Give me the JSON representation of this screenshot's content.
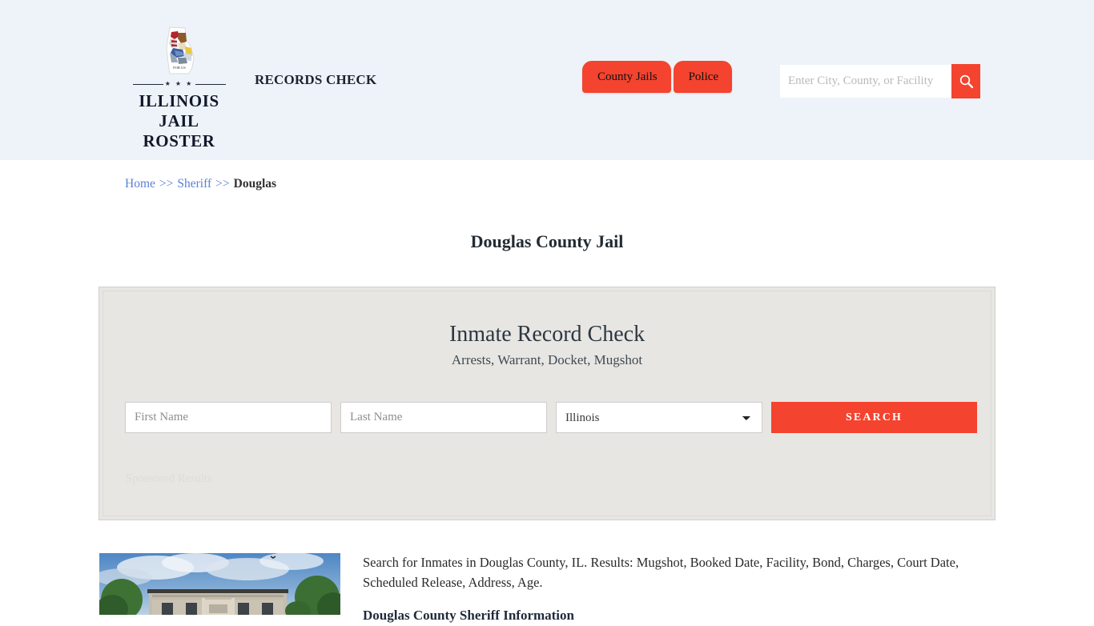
{
  "header": {
    "brand": {
      "line1": "ILLINOIS",
      "line2": "JAIL ROSTER",
      "stars": "★ ★ ★",
      "logo_icon": "illinois-state-seal-icon"
    },
    "tagline": "RECORDS CHECK",
    "nav": [
      {
        "label": "County Jails",
        "name": "nav-county-jails"
      },
      {
        "label": "Police",
        "name": "nav-police"
      }
    ],
    "search": {
      "placeholder": "Enter City, County, or Facility",
      "value": "",
      "button_icon": "search-icon"
    },
    "background_color": "#eef3f9",
    "accent_color": "#f4432e"
  },
  "breadcrumb": {
    "home": "Home",
    "sep1": ">>",
    "sheriff": "Sheriff",
    "sep2": ">>",
    "current": "Douglas"
  },
  "page_title": "Douglas County Jail",
  "panel": {
    "title": "Inmate Record Check",
    "subtitle": "Arrests, Warrant, Docket, Mugshot",
    "form": {
      "first_name_placeholder": "First Name",
      "first_name_value": "",
      "last_name_placeholder": "Last Name",
      "last_name_value": "",
      "state_selected": "Illinois",
      "state_options": [
        "Illinois"
      ],
      "submit_label": "SEARCH"
    },
    "sponsored_label": "Sponsored Results",
    "background_color": "#e8e6e2"
  },
  "content": {
    "thumbnail_alt": "douglas-county-courthouse-photo",
    "paragraph": "Search for Inmates in Douglas County, IL. Results: Mugshot, Booked Date, Facility, Bond, Charges, Court Date, Scheduled Release, Address, Age.",
    "subheading": "Douglas County Sheriff Information"
  }
}
